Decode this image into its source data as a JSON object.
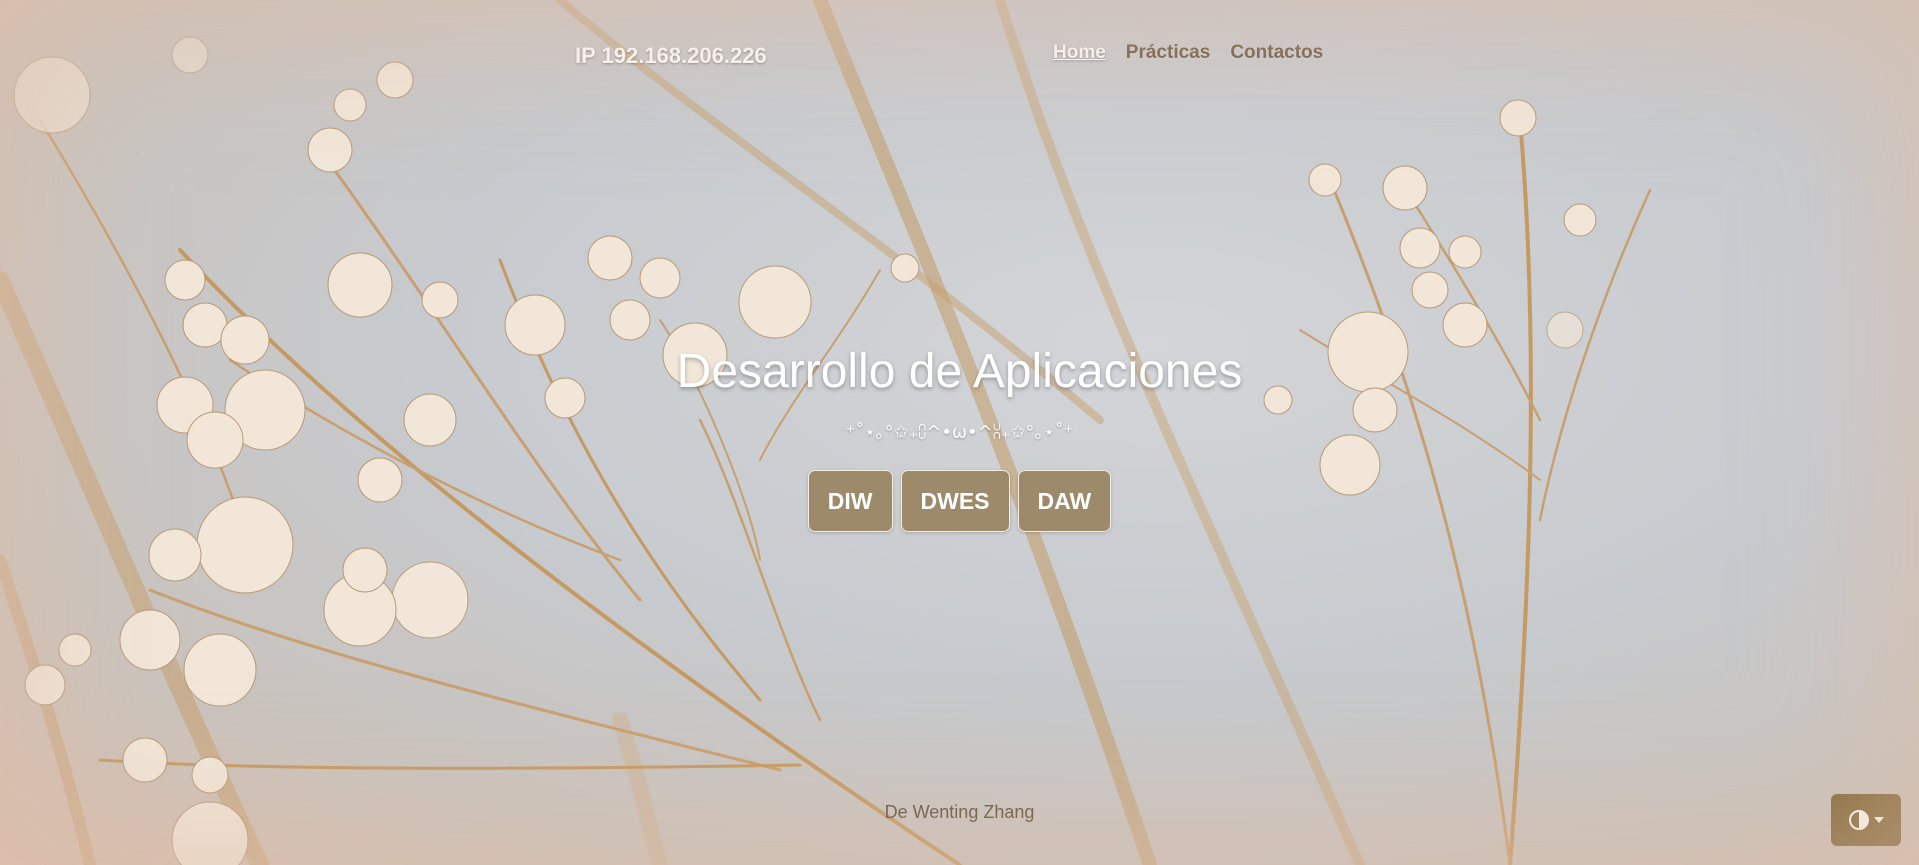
{
  "navbar": {
    "brand": "IP 192.168.206.226",
    "links": [
      {
        "label": "Home",
        "active": true
      },
      {
        "label": "Prácticas",
        "active": false
      },
      {
        "label": "Contactos",
        "active": false
      }
    ]
  },
  "hero": {
    "title": "Desarrollo de Aplicaciones",
    "kaomoji": "⁺˚⋆｡°✩₊⩇^•ω•^⩆₊✩°｡⋆˚⁺",
    "buttons": [
      "DIW",
      "DWES",
      "DAW"
    ]
  },
  "footer": {
    "credit": "De Wenting Zhang"
  },
  "theme_toggle": {
    "icon": "half-circle-contrast-icon"
  },
  "colors": {
    "button_bg": "#9c8a6b",
    "toggle_bg": "#7b6230",
    "nav_link": "#6b5a43",
    "text_light": "#ffffff"
  }
}
